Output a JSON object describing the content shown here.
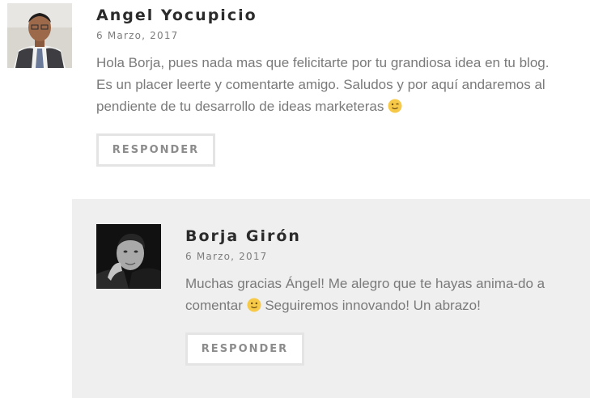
{
  "comments": [
    {
      "author": "Angel Yocupicio",
      "date": "6 Marzo, 2017",
      "text": "Hola Borja, pues nada mas que felicitarte por tu grandiosa idea en tu blog. Es un placer leerte y comentarte amigo. Saludos y por aquí andaremos al pendiente de tu desarrollo de ideas marketeras",
      "emoji": "wink-emoji",
      "reply_label": "RESPONDER"
    },
    {
      "author": "Borja Girón",
      "date": "6 Marzo, 2017",
      "text_before": "Muchas gracias Ángel! Me alegro que te hayas anima-do a comentar",
      "emoji": "smile-emoji",
      "text_after": "Seguiremos innovando! Un abrazo!",
      "reply_label": "RESPONDER"
    }
  ],
  "colors": {
    "author": "#2b2b2b",
    "date": "#7d7d7d",
    "text": "#7a7a7a",
    "reply_background": "#efefef",
    "button_border": "#e4e4e4",
    "button_text": "#8c8c8c"
  }
}
